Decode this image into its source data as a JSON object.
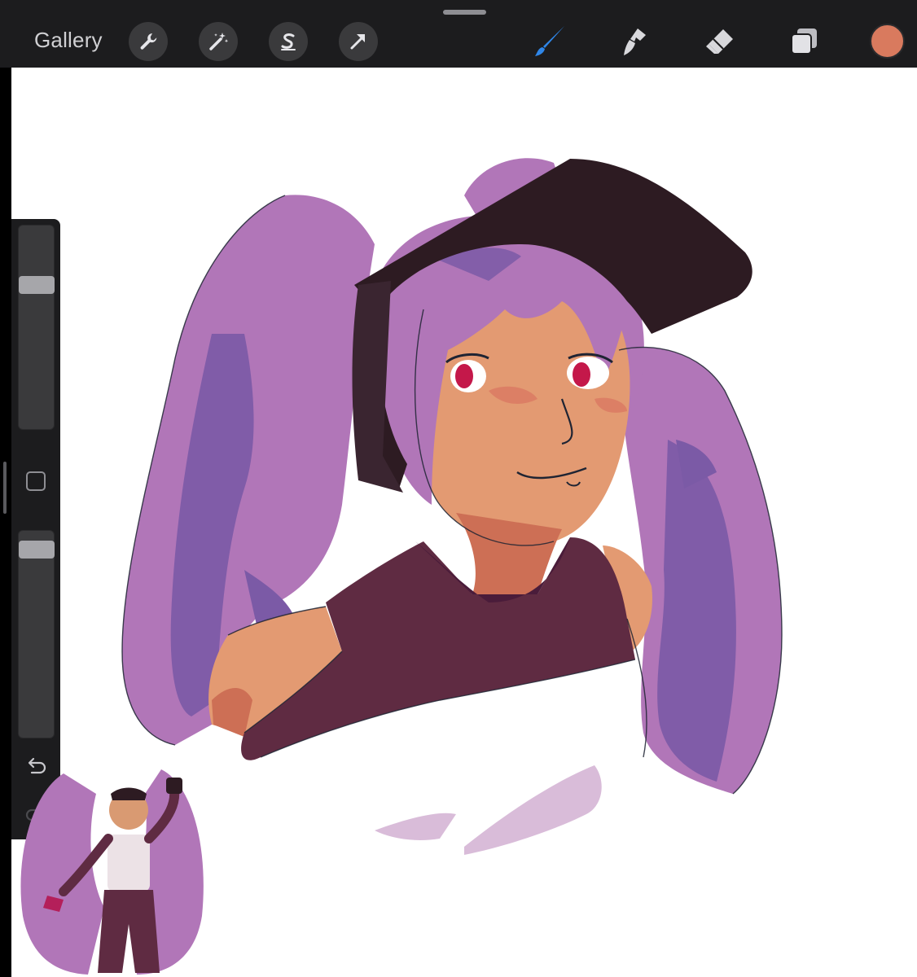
{
  "topbar": {
    "gallery_label": "Gallery",
    "left_tools": [
      "wrench-icon",
      "magic-wand-icon",
      "selection-s-icon",
      "transform-arrow-icon"
    ],
    "right_tools": [
      "brush-icon",
      "smudge-icon",
      "eraser-icon",
      "layers-icon"
    ],
    "active_tool": "brush",
    "active_color": "#d97a5e",
    "brush_active_color": "#2f86e8"
  },
  "sidebar": {
    "brush_size": 0.27,
    "opacity": 0.95,
    "icons": [
      "modify-square-icon",
      "undo-icon",
      "redo-icon"
    ]
  },
  "canvas": {
    "palette": {
      "hair": "#b176b8",
      "hair_shadow": "#7b5aa6",
      "skin": "#e39a72",
      "skin_shadow": "#cd6f55",
      "top": "#5f2b42",
      "collar": "#4a1c3a",
      "headband": "#2d1b22",
      "eye": "#c4184a",
      "lines": "#1f2433"
    }
  }
}
